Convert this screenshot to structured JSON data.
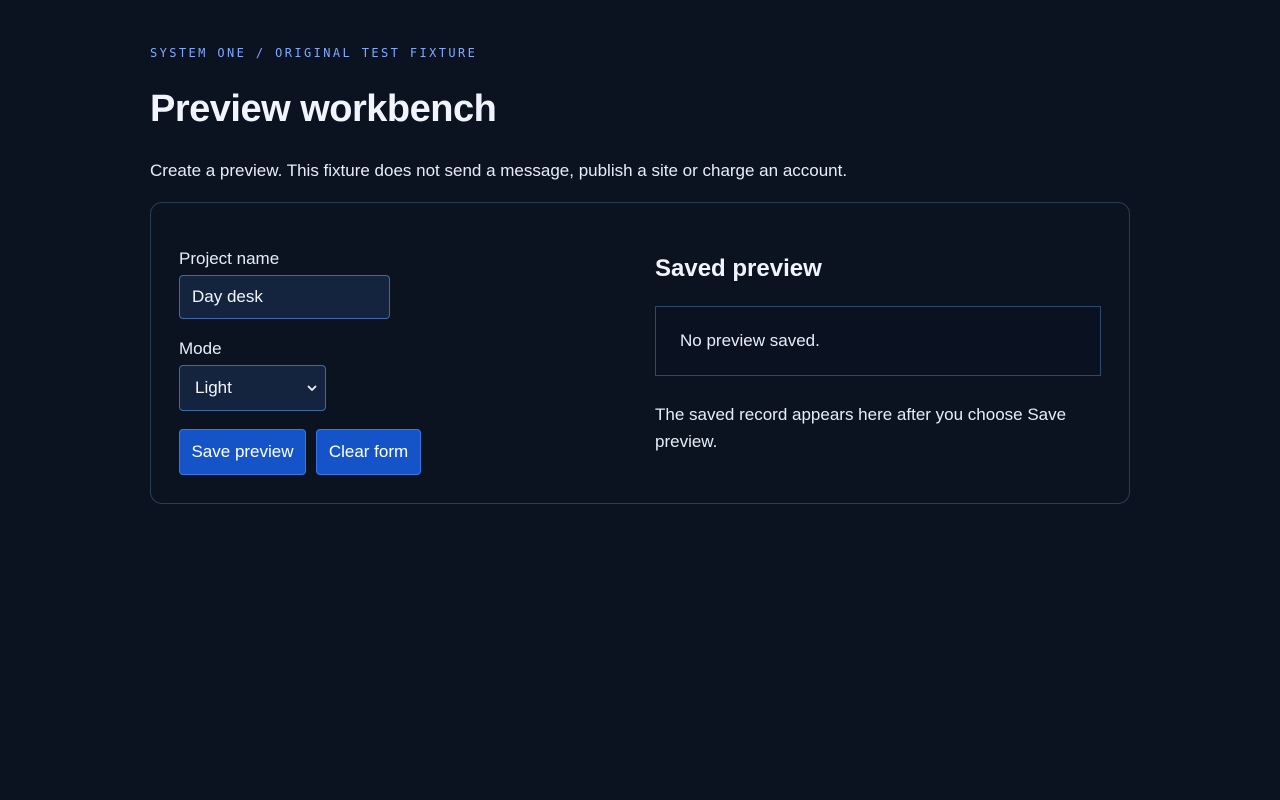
{
  "header": {
    "eyebrow": "SYSTEM ONE / ORIGINAL TEST FIXTURE",
    "title": "Preview workbench",
    "lead": "Create a preview. This fixture does not send a message, publish a site or charge an account."
  },
  "form": {
    "project_name_label": "Project name",
    "project_name_value": "Day desk",
    "mode_label": "Mode",
    "mode_selected": "Light",
    "save_button": "Save preview",
    "clear_button": "Clear form"
  },
  "preview": {
    "heading": "Saved preview",
    "status": "No preview saved.",
    "note": "The saved record appears here after you choose Save preview."
  },
  "icons": {
    "select_arrow": "chevron-down-icon"
  },
  "colors": {
    "background": "#0b1220",
    "accent": "#7fa8ff",
    "button": "#1554c8",
    "input": "#14243f",
    "border": "#2a3d58"
  }
}
